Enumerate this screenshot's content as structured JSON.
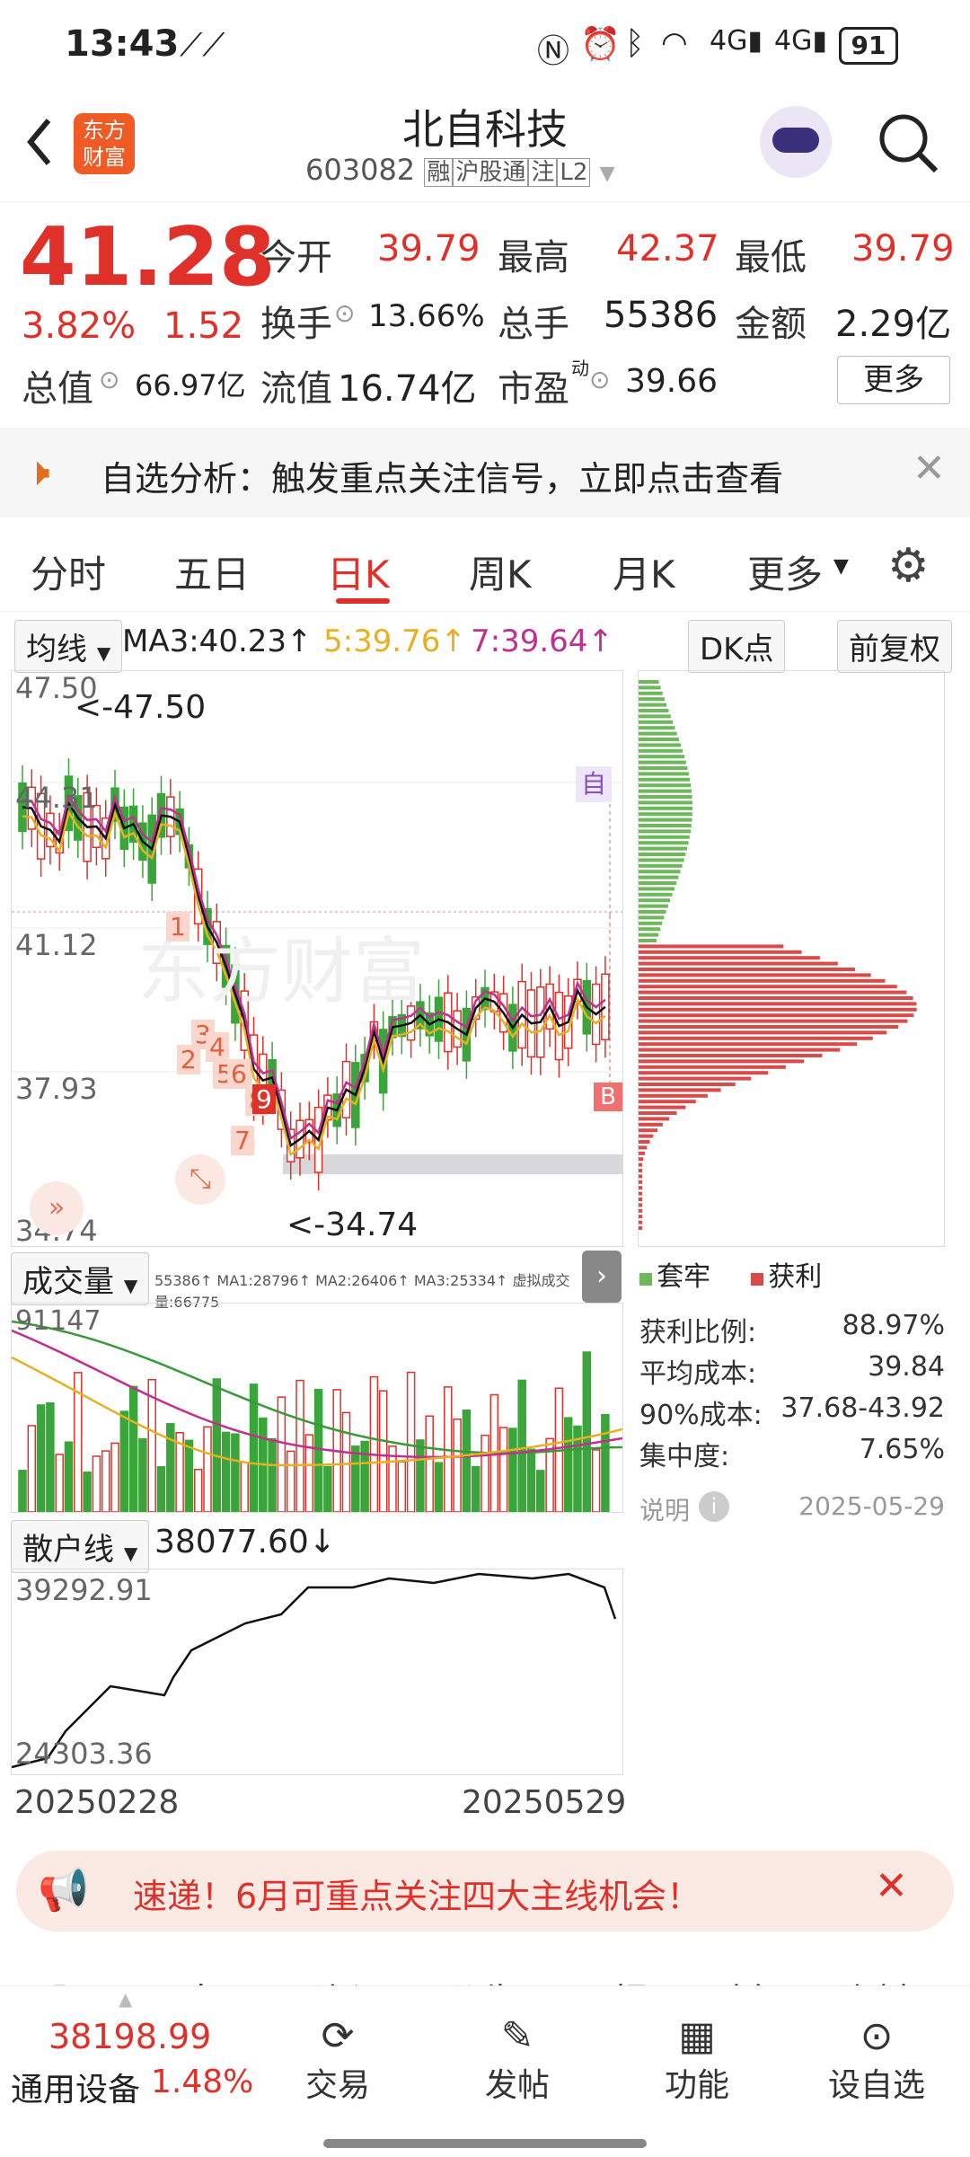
{
  "status_bar": {
    "time": "13:43",
    "battery": "91"
  },
  "header": {
    "logo_text": "东方财富",
    "stock_name": "北自科技",
    "stock_code": "603082",
    "tags": [
      "融",
      "沪股通",
      "注",
      "L2"
    ]
  },
  "quote": {
    "price": "41.28",
    "change_pct": "3.82%",
    "change_abs": "1.52",
    "open_label": "今开",
    "open": "39.79",
    "high_label": "最高",
    "high": "42.37",
    "low_label": "最低",
    "low": "39.79",
    "turnover_label": "换手",
    "turnover": "13.66%",
    "volume_label": "总手",
    "volume": "55386",
    "amount_label": "金额",
    "amount": "2.29亿",
    "total_mv_label": "总值",
    "total_mv": "66.97亿",
    "float_mv_label": "流值",
    "float_mv": "16.74亿",
    "pe_label": "市盈",
    "pe_sup": "动",
    "pe": "39.66",
    "more_button": "更多"
  },
  "alert_banner": {
    "text": "自选分析：触发重点关注信号，立即点击查看"
  },
  "chart_tabs": {
    "items": [
      "分时",
      "五日",
      "日K",
      "周K",
      "月K",
      "更多"
    ],
    "active": "日K"
  },
  "kline_legend": {
    "selector": "均线",
    "ma3": "MA3:40.23↑",
    "ma5": "5:39.76↑",
    "ma7": "7:39.64↑",
    "dk": "DK点",
    "adjust": "前复权"
  },
  "kline_axis": {
    "top": "47.50",
    "l2": "44.31",
    "l3": "41.12",
    "l4": "37.93",
    "bottom": "34.74"
  },
  "kline_annotations": {
    "high": "<-47.50",
    "low": "<-34.74",
    "self_tag": "自",
    "buy_tag": "B",
    "watermark": "东方财富"
  },
  "kline_signals": [
    "1",
    "2",
    "3",
    "4",
    "5",
    "6",
    "7",
    "8",
    "9"
  ],
  "volume_legend": {
    "selector": "成交量",
    "text": "55386↑ MA1:28796↑ MA2:26406↑ MA3:25334↑ 虚拟成交量:66775",
    "axis_top": "91147"
  },
  "retail_legend": {
    "selector": "散户线",
    "value": "38077.60↓",
    "axis_top": "39292.91",
    "axis_bottom": "24303.36",
    "date_start": "20250228",
    "date_end": "20250529"
  },
  "chip_panel": {
    "legend_trapped": "套牢",
    "legend_profit": "获利",
    "stats": [
      {
        "label": "获利比例:",
        "value": "88.97%"
      },
      {
        "label": "平均成本:",
        "value": "39.84"
      },
      {
        "label": "90%成本:",
        "value": "37.68-43.92"
      },
      {
        "label": "集中度:",
        "value": "7.65%"
      }
    ],
    "note_label": "说明",
    "date": "2025-05-29"
  },
  "promo_banner": {
    "text": "速递！6月可重点关注四大主线机会！"
  },
  "sub_tabs": [
    "股吧",
    "盘口",
    "资讯",
    "公告",
    "研报",
    "财务",
    "资料"
  ],
  "bottom_bar": {
    "index_value": "38198.99",
    "index_name": "通用设备",
    "index_change": "1.48%",
    "buttons": [
      "交易",
      "发帖",
      "功能",
      "设自选"
    ]
  },
  "colors": {
    "up": "#e0302a",
    "down": "#3aa53a",
    "ma_yellow": "#e8b020",
    "ma_purple": "#c0308f",
    "ma_black": "#111"
  }
}
